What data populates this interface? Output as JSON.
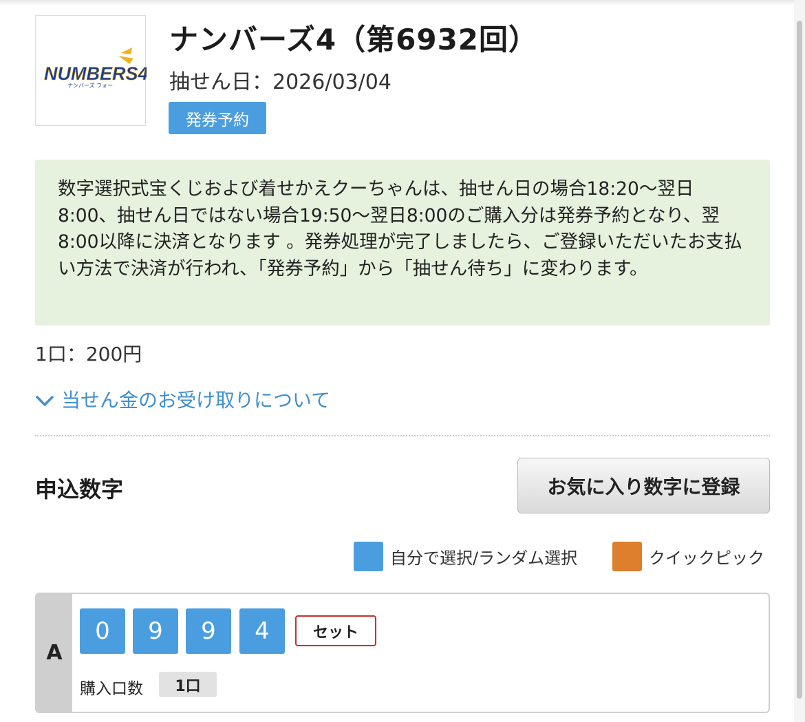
{
  "lottery": {
    "logo_alt": "NUMBERS4",
    "logo_text": "NUMBERS4",
    "logo_subtext": "ナンバーズ フォー",
    "title": "ナンバーズ4（第6932回）",
    "draw_date": "抽せん日：2026/03/04",
    "status_badge": "発券予約"
  },
  "notice": {
    "text": "数字選択式宝くじおよび着せかえクーちゃんは、抽せん日の場合18:20〜翌日8:00、抽せん日ではない場合19:50〜翌日8:00のご購入分は発券予約となり、翌8:00以降に決済となります 。発券処理が完了しましたら、ご登録いただいたお支払い方法で決済が行われ、「発券予約」から「抽せん待ち」に変わります。"
  },
  "price": "1口：200円",
  "prize_link": "当せん金のお受け取りについて",
  "selection": {
    "heading": "申込数字",
    "favorite_button": "お気に入り数字に登録",
    "legend": {
      "manual": "自分で選択/ランダム選択",
      "quick": "クイックピック"
    },
    "entries": [
      {
        "label": "A",
        "digits": [
          "0",
          "9",
          "9",
          "4"
        ],
        "set_button": "セット",
        "quantity_label": "購入口数",
        "quantity_value": "1口"
      }
    ]
  },
  "colors": {
    "accent_blue": "#4a9ee0",
    "quick_pick_orange": "#dd7f2c",
    "notice_bg": "#e6f1de",
    "link_blue": "#3f8fd0",
    "set_border_red": "#c9302c"
  },
  "icons": {
    "prize_link": "chevron-down-icon"
  }
}
